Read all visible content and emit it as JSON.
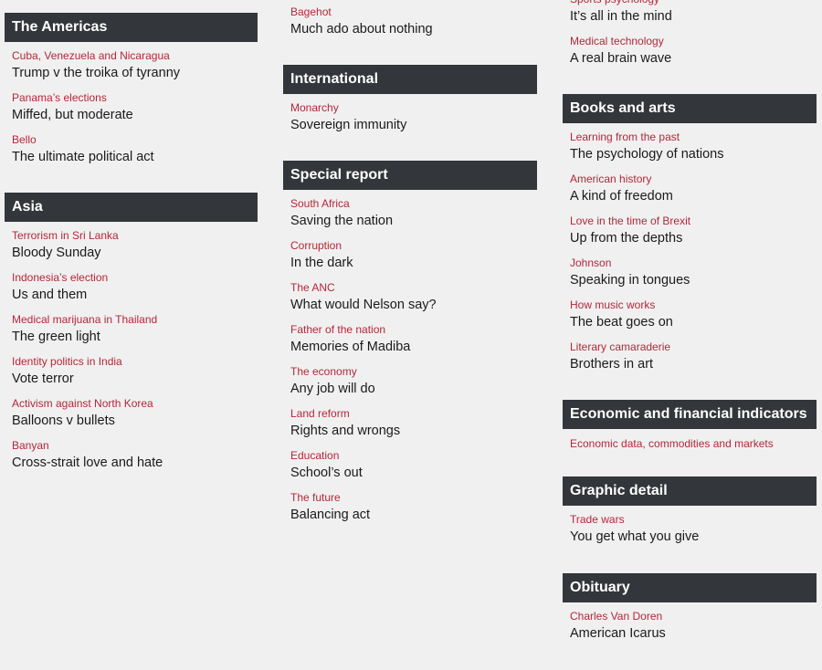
{
  "sections": [
    {
      "id": "the-americas",
      "title": "The Americas",
      "items": [
        {
          "kicker": "Cuba, Venezuela and Nicaragua",
          "headline": "Trump v the troika of tyranny"
        },
        {
          "kicker": "Panama’s elections",
          "headline": "Miffed, but moderate"
        },
        {
          "kicker": "Bello",
          "headline": "The ultimate political act"
        }
      ]
    },
    {
      "id": "asia",
      "title": "Asia",
      "items": [
        {
          "kicker": "Terrorism in Sri Lanka",
          "headline": "Bloody Sunday"
        },
        {
          "kicker": "Indonesia’s election",
          "headline": "Us and them"
        },
        {
          "kicker": "Medical marijuana in Thailand",
          "headline": "The green light"
        },
        {
          "kicker": "Identity politics in India",
          "headline": "Vote terror"
        },
        {
          "kicker": "Activism against North Korea",
          "headline": "Balloons v bullets"
        },
        {
          "kicker": "Banyan",
          "headline": "Cross-strait love and hate"
        }
      ]
    },
    {
      "id": "britain-continued",
      "title": "",
      "items": [
        {
          "kicker": "Bagehot",
          "headline": "Much ado about nothing"
        }
      ]
    },
    {
      "id": "international",
      "title": "International",
      "items": [
        {
          "kicker": "Monarchy",
          "headline": "Sovereign immunity"
        }
      ]
    },
    {
      "id": "special-report",
      "title": "Special report",
      "items": [
        {
          "kicker": "South Africa",
          "headline": "Saving the nation"
        },
        {
          "kicker": "Corruption",
          "headline": "In the dark"
        },
        {
          "kicker": "The ANC",
          "headline": "What would Nelson say?"
        },
        {
          "kicker": "Father of the nation",
          "headline": "Memories of Madiba"
        },
        {
          "kicker": "The economy",
          "headline": "Any job will do"
        },
        {
          "kicker": "Land reform",
          "headline": "Rights and wrongs"
        },
        {
          "kicker": "Education",
          "headline": "School’s out"
        },
        {
          "kicker": "The future",
          "headline": "Balancing act"
        }
      ]
    },
    {
      "id": "science-continued",
      "title": "",
      "items": [
        {
          "kicker": "Sports psychology",
          "headline": "It’s all in the mind"
        },
        {
          "kicker": "Medical technology",
          "headline": "A real brain wave"
        }
      ]
    },
    {
      "id": "books-and-arts",
      "title": "Books and arts",
      "items": [
        {
          "kicker": "Learning from the past",
          "headline": "The psychology of nations"
        },
        {
          "kicker": "American history",
          "headline": "A kind of freedom"
        },
        {
          "kicker": "Love in the time of Brexit",
          "headline": "Up from the depths"
        },
        {
          "kicker": "Johnson",
          "headline": "Speaking in tongues"
        },
        {
          "kicker": "How music works",
          "headline": "The beat goes on"
        },
        {
          "kicker": "Literary camaraderie",
          "headline": "Brothers in art"
        }
      ]
    },
    {
      "id": "economic-and-financial-indicators",
      "title": "Economic and financial indicators",
      "link": "Economic data, commodities and markets",
      "items": []
    },
    {
      "id": "graphic-detail",
      "title": "Graphic detail",
      "items": [
        {
          "kicker": "Trade wars",
          "headline": "You get what you give"
        }
      ]
    },
    {
      "id": "obituary",
      "title": "Obituary",
      "items": [
        {
          "kicker": "Charles Van Doren",
          "headline": "American Icarus"
        }
      ]
    }
  ],
  "colors": {
    "background": "#f0f0f0",
    "header": "#33363a",
    "kicker": "#b5263a",
    "headline": "#1a1a1a"
  }
}
